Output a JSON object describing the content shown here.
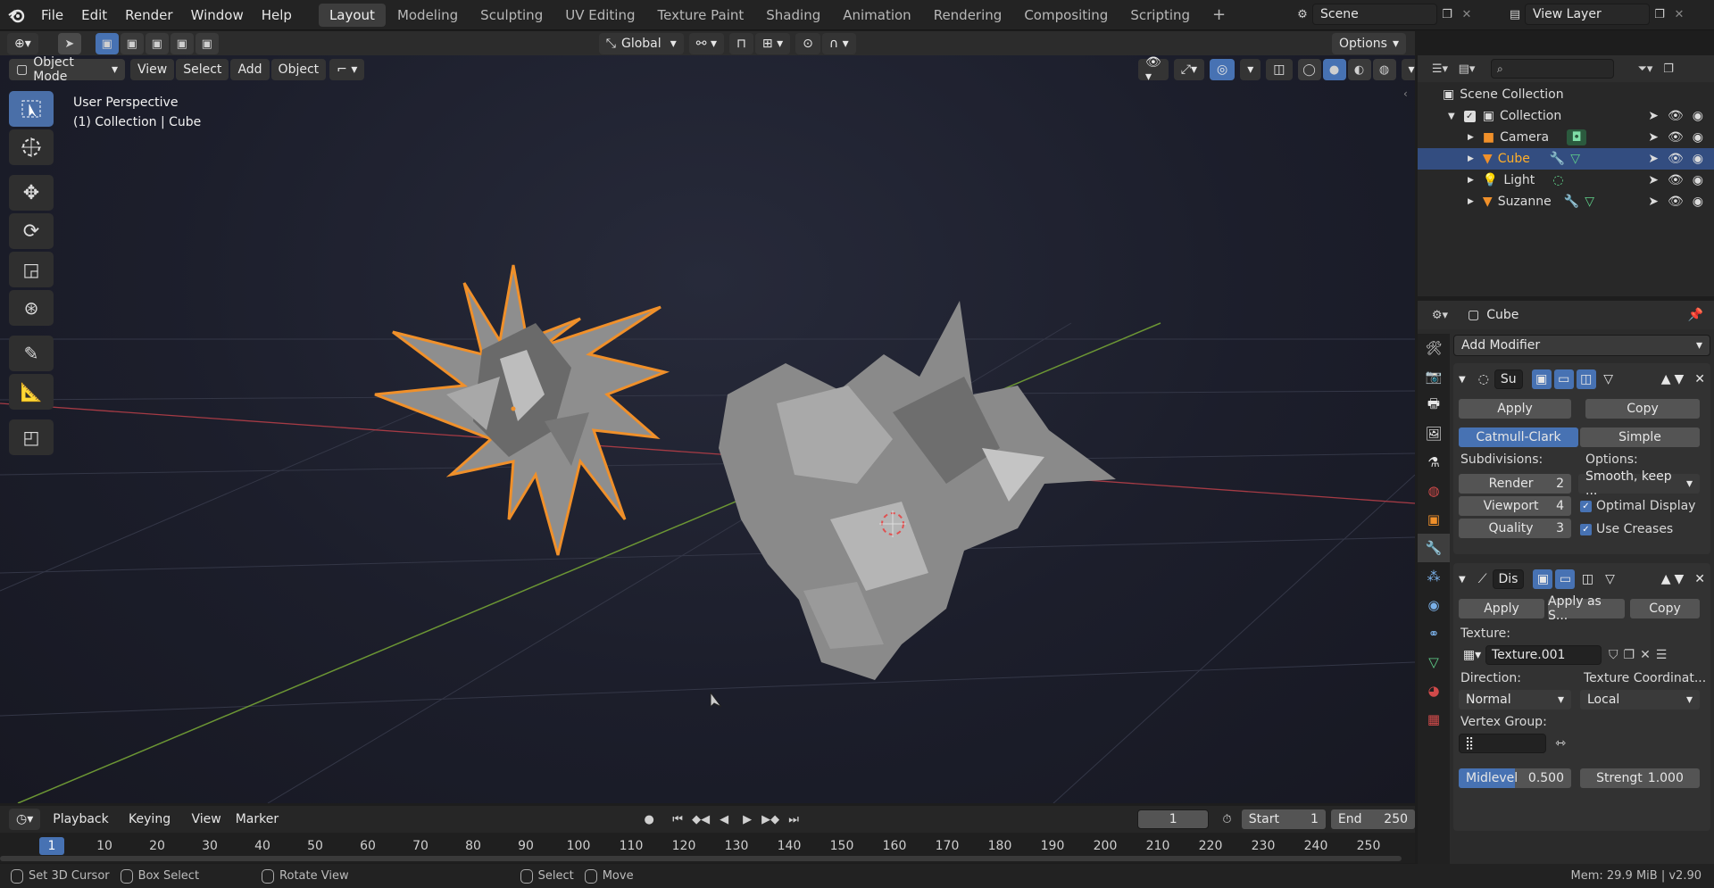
{
  "app": {
    "name": "Blender",
    "version": "v2.90",
    "memory": "Mem: 29.9 MiB"
  },
  "menus": [
    "File",
    "Edit",
    "Render",
    "Window",
    "Help"
  ],
  "workspaces": [
    "Layout",
    "Modeling",
    "Sculpting",
    "UV Editing",
    "Texture Paint",
    "Shading",
    "Animation",
    "Rendering",
    "Compositing",
    "Scripting"
  ],
  "active_workspace": "Layout",
  "scene": {
    "name": "Scene",
    "view_layer": "View Layer"
  },
  "viewport_header": {
    "mode": "Object Mode",
    "menus": [
      "View",
      "Select",
      "Add",
      "Object"
    ],
    "orientation": "Global",
    "options": "Options"
  },
  "viewport": {
    "perspective": "User Perspective",
    "context": "(1) Collection | Cube"
  },
  "outliner": {
    "root": "Scene Collection",
    "collection": "Collection",
    "items": [
      {
        "name": "Camera",
        "icon": "camera-icon",
        "selected": false
      },
      {
        "name": "Cube",
        "icon": "mesh-icon",
        "selected": true
      },
      {
        "name": "Light",
        "icon": "light-icon",
        "selected": false
      },
      {
        "name": "Suzanne",
        "icon": "mesh-icon",
        "selected": false
      }
    ]
  },
  "properties": {
    "object": "Cube",
    "add_modifier": "Add Modifier",
    "subsurf": {
      "name": "Su",
      "apply": "Apply",
      "copy": "Copy",
      "types": [
        "Catmull-Clark",
        "Simple"
      ],
      "active_type": "Catmull-Clark",
      "subdivisions_label": "Subdivisions:",
      "options_label": "Options:",
      "render_label": "Render",
      "render_value": "2",
      "viewport_label": "Viewport",
      "viewport_value": "4",
      "quality_label": "Quality",
      "quality_value": "3",
      "uv_smooth": "Smooth, keep ...",
      "optimal_display": "Optimal Display",
      "use_creases": "Use Creases"
    },
    "displace": {
      "name": "Dis",
      "apply": "Apply",
      "apply_shape": "Apply as S...",
      "copy": "Copy",
      "texture_label": "Texture:",
      "texture": "Texture.001",
      "direction_label": "Direction:",
      "direction": "Normal",
      "coords_label": "Texture Coordinat...",
      "coords": "Local",
      "vgroup_label": "Vertex Group:",
      "midlevel_label": "Midlevel",
      "midlevel": "0.500",
      "strength_label": "Strengt",
      "strength": "1.000"
    }
  },
  "timeline": {
    "menus": [
      "Playback",
      "Keying",
      "View",
      "Marker"
    ],
    "current": "1",
    "start_label": "Start",
    "start": "1",
    "end_label": "End",
    "end": "250",
    "ruler": [
      "1",
      "10",
      "20",
      "30",
      "40",
      "50",
      "60",
      "70",
      "80",
      "90",
      "100",
      "110",
      "120",
      "130",
      "140",
      "150",
      "160",
      "170",
      "180",
      "190",
      "200",
      "210",
      "220",
      "230",
      "240",
      "250"
    ]
  },
  "status": {
    "set_cursor": "Set 3D Cursor",
    "box_select": "Box Select",
    "rotate": "Rotate View",
    "select": "Select",
    "move": "Move"
  },
  "colors": {
    "accent": "#4772b3",
    "selection_outline": "#f0902a",
    "x_axis": "#b43c46",
    "y_axis": "#6f9a34"
  }
}
